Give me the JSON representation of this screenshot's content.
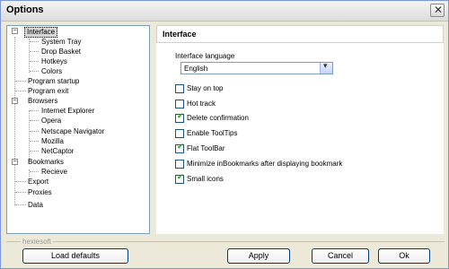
{
  "window": {
    "title": "Options",
    "close_glyph": "✕"
  },
  "tree": [
    {
      "label": "Interface"
    },
    {
      "label": "System Tray"
    },
    {
      "label": "Drop Basket"
    },
    {
      "label": "Hotkeys"
    },
    {
      "label": "Colors"
    },
    {
      "label": "Program startup"
    },
    {
      "label": "Program exit"
    },
    {
      "label": "Browsers"
    },
    {
      "label": "Internet Explorer"
    },
    {
      "label": "Opera"
    },
    {
      "label": "Netscape Navigator"
    },
    {
      "label": "Mozilla"
    },
    {
      "label": "NetCaptor"
    },
    {
      "label": "Bookmarks"
    },
    {
      "label": "Recieve"
    },
    {
      "label": "Export"
    },
    {
      "label": "Proxies"
    },
    {
      "label": "Data"
    }
  ],
  "panel": {
    "header": "Interface",
    "language_label": "Interface language",
    "language_value": "English",
    "checkboxes": [
      {
        "label": "Stay on top",
        "checked": false
      },
      {
        "label": "Hot track",
        "checked": false
      },
      {
        "label": "Delete confirmation",
        "checked": true
      },
      {
        "label": "Enable ToolTips",
        "checked": false
      },
      {
        "label": "Flat ToolBar",
        "checked": true
      },
      {
        "label": "Minimize inBookmarks after displaying bookmark",
        "checked": false
      },
      {
        "label": "Small icons",
        "checked": true
      }
    ]
  },
  "footer": {
    "brand": "hexiesoft",
    "load_defaults": "Load defaults",
    "apply": "Apply",
    "cancel": "Cancel",
    "ok": "Ok"
  },
  "colors": {
    "accent": "#003c74",
    "check": "#21a121"
  }
}
